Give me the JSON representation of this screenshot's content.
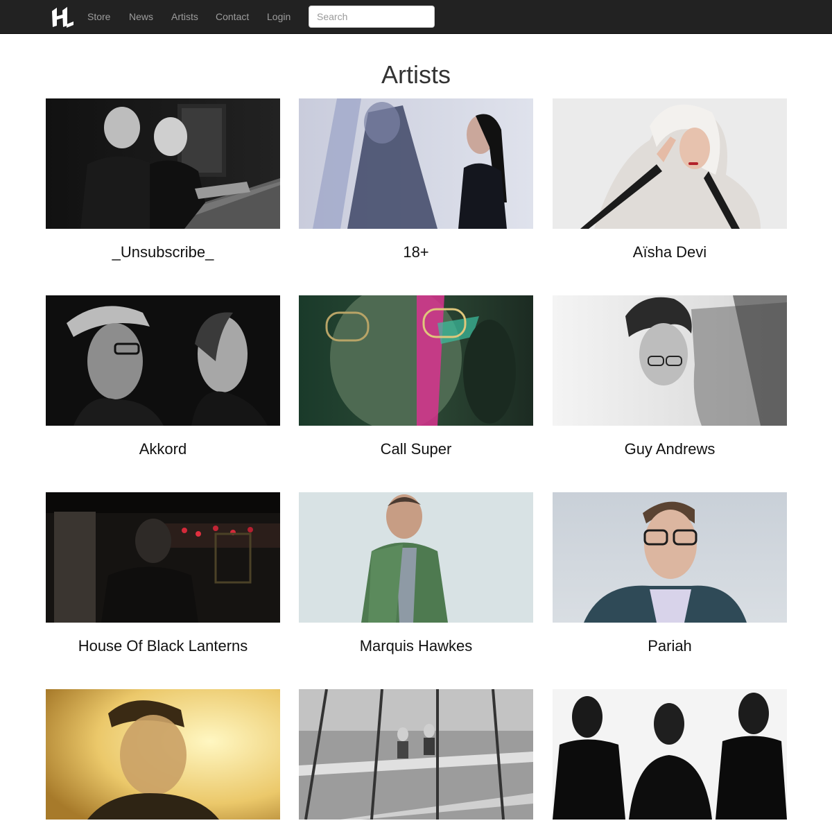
{
  "nav": {
    "logo_alt": "H",
    "links": [
      {
        "label": "Store"
      },
      {
        "label": "News"
      },
      {
        "label": "Artists"
      },
      {
        "label": "Contact"
      },
      {
        "label": "Login"
      }
    ],
    "search_placeholder": "Search"
  },
  "page": {
    "title": "Artists"
  },
  "artists": [
    {
      "name": "_Unsubscribe_",
      "photo": "dark-studio-mixing-desk"
    },
    {
      "name": "18+",
      "photo": "pale-blue-duo-profile"
    },
    {
      "name": "Aïsha Devi",
      "photo": "white-hooded-portrait"
    },
    {
      "name": "Akkord",
      "photo": "bw-two-men-profile"
    },
    {
      "name": "Call Super",
      "photo": "green-magenta-glasses-portrait"
    },
    {
      "name": "Guy Andrews",
      "photo": "bw-double-exposure-portrait"
    },
    {
      "name": "House Of Black Lanterns",
      "photo": "dark-red-lit-room"
    },
    {
      "name": "Marquis Hawkes",
      "photo": "green-jacket-man-wall"
    },
    {
      "name": "Pariah",
      "photo": "glasses-man-teal-jacket"
    },
    {
      "name": "",
      "photo": "yellow-cap-portrait"
    },
    {
      "name": "",
      "photo": "grey-stairwell-window"
    },
    {
      "name": "",
      "photo": "bw-trio-silhouette"
    }
  ],
  "colors": {
    "navbar_bg": "#222222",
    "nav_link": "#9d9d9d",
    "page_bg": "#ffffff"
  }
}
